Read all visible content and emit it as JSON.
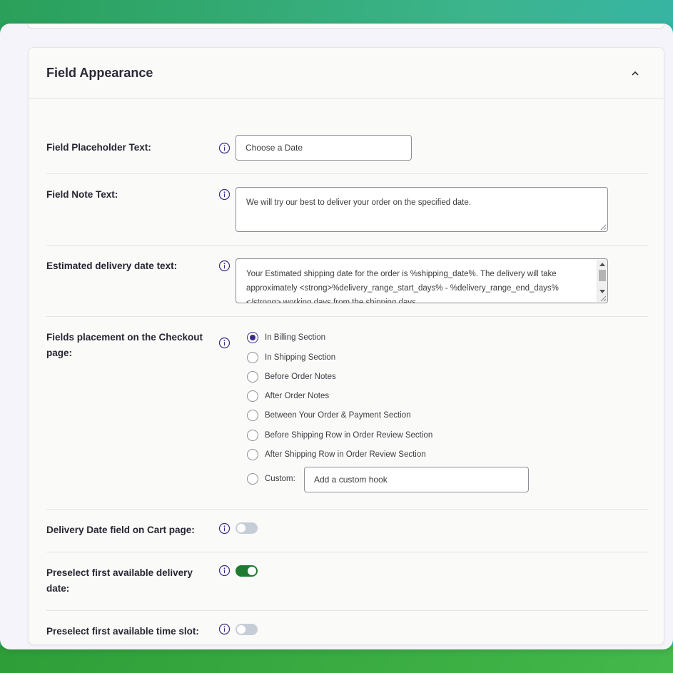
{
  "card": {
    "title": "Field Appearance"
  },
  "placeholder_row": {
    "label": "Field Placeholder Text:",
    "value": "Choose a Date"
  },
  "note_row": {
    "label": "Field Note Text:",
    "value": "We will try our best to deliver your order on the specified date."
  },
  "estimated_row": {
    "label": "Estimated delivery date text:",
    "value": "Your Estimated shipping date for the order is %shipping_date%. The delivery will take approximately <strong>%delivery_range_start_days% - %delivery_range_end_days%</strong> working days from the shipping days."
  },
  "placement_row": {
    "label_line1": "Fields placement on the Checkout",
    "label_line2": "page:",
    "options": [
      {
        "label": "In Billing Section",
        "checked": true
      },
      {
        "label": "In Shipping Section",
        "checked": false
      },
      {
        "label": "Before Order Notes",
        "checked": false
      },
      {
        "label": "After Order Notes",
        "checked": false
      },
      {
        "label": "Between Your Order & Payment Section",
        "checked": false
      },
      {
        "label": "Before Shipping Row in Order Review Section",
        "checked": false
      },
      {
        "label": "After Shipping Row in Order Review Section",
        "checked": false
      }
    ],
    "custom_label": "Custom:",
    "custom_value": "Add a custom hook"
  },
  "cart_row": {
    "label": "Delivery Date field on Cart page:",
    "enabled": false
  },
  "preselect_date_row": {
    "label_line1": "Preselect first available delivery",
    "label_line2": "date:",
    "enabled": true
  },
  "preselect_slot_row": {
    "label": "Preselect first available time slot:",
    "enabled": false
  },
  "colors": {
    "accent": "#3a2d8a",
    "toggle_on": "#1f7a32",
    "toggle_off": "#c7cdd6"
  }
}
